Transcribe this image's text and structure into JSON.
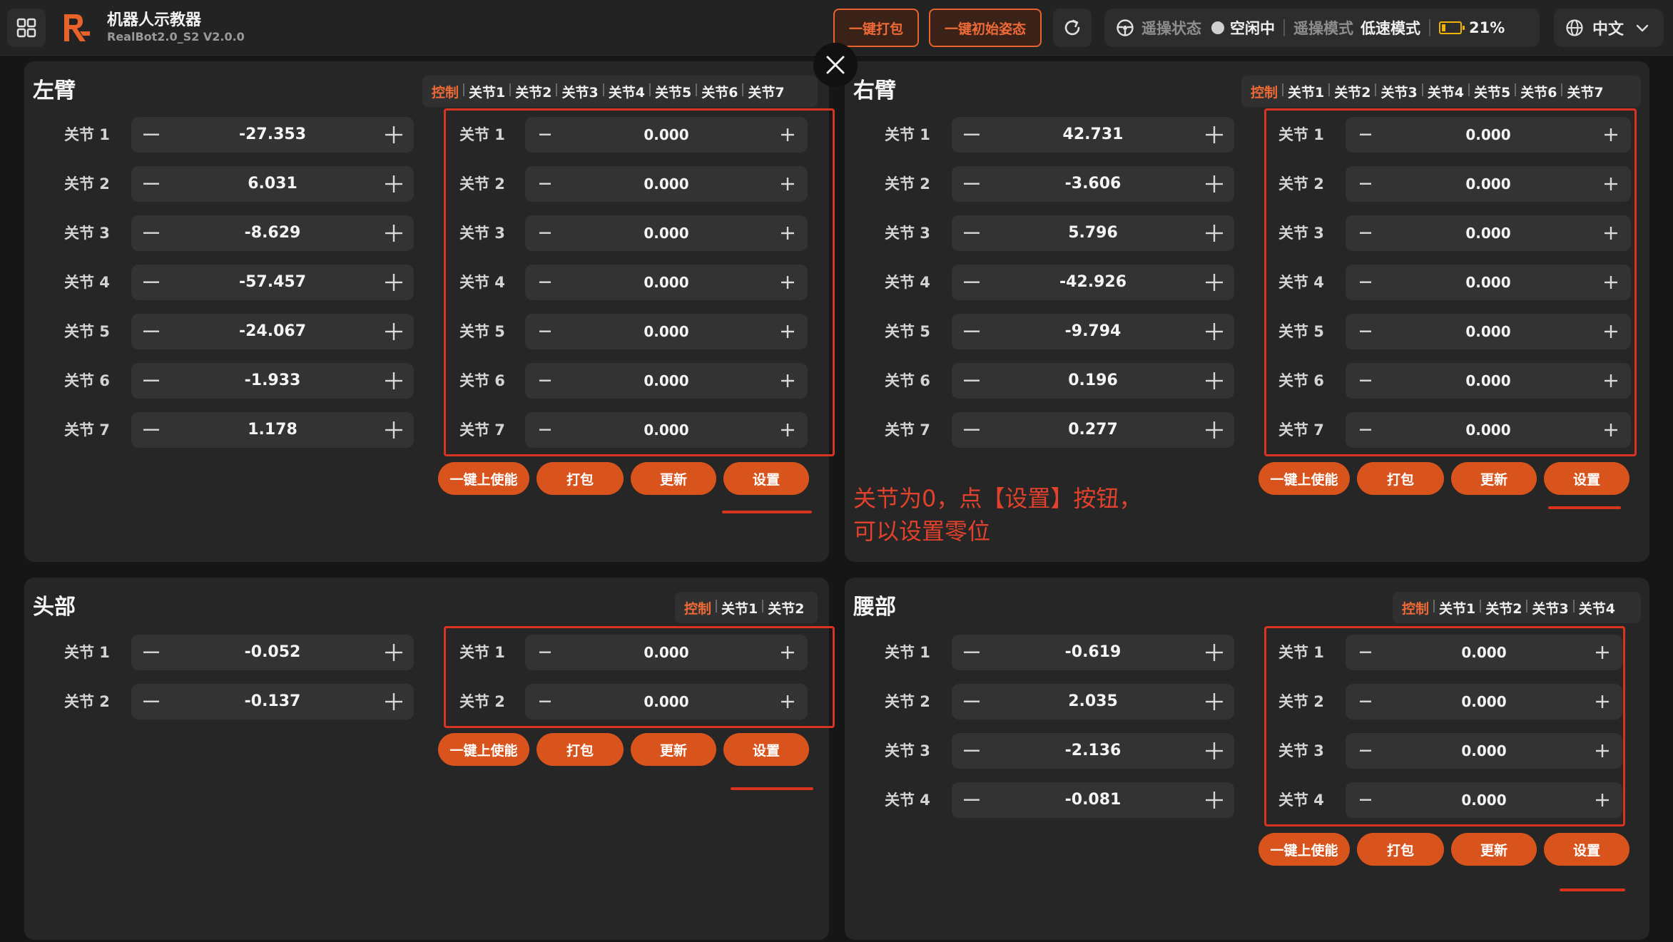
{
  "header": {
    "app_title": "机器人示教器",
    "app_version": "RealBot2.0_S2 V2.0.0",
    "pack_all_label": "一键打包",
    "init_pose_label": "一键初始姿态",
    "teleop_status_label": "遥操状态",
    "teleop_status_value": "空闲中",
    "teleop_mode_label": "遥操模式",
    "teleop_mode_value": "低速模式",
    "battery_percent": 21,
    "battery_text": "21%",
    "language": "中文"
  },
  "colors": {
    "accent": "#e8622c",
    "annotation": "#d9341f",
    "panel": "#262626",
    "battery": "#f0b400"
  },
  "common": {
    "tab_control": "控制",
    "btn_enable": "一键上使能",
    "btn_pack": "打包",
    "btn_update": "更新",
    "btn_set": "设置"
  },
  "left_arm": {
    "title": "左臂",
    "tabs": [
      "关节1",
      "关节2",
      "关节3",
      "关节4",
      "关节5",
      "关节6",
      "关节7"
    ],
    "joints": [
      {
        "label": "关节 1",
        "value": "-27.353",
        "offset": "0.000"
      },
      {
        "label": "关节 2",
        "value": "6.031",
        "offset": "0.000"
      },
      {
        "label": "关节 3",
        "value": "-8.629",
        "offset": "0.000"
      },
      {
        "label": "关节 4",
        "value": "-57.457",
        "offset": "0.000"
      },
      {
        "label": "关节 5",
        "value": "-24.067",
        "offset": "0.000"
      },
      {
        "label": "关节 6",
        "value": "-1.933",
        "offset": "0.000"
      },
      {
        "label": "关节 7",
        "value": "1.178",
        "offset": "0.000"
      }
    ]
  },
  "right_arm": {
    "title": "右臂",
    "tabs": [
      "关节1",
      "关节2",
      "关节3",
      "关节4",
      "关节5",
      "关节6",
      "关节7"
    ],
    "joints": [
      {
        "label": "关节 1",
        "value": "42.731",
        "offset": "0.000"
      },
      {
        "label": "关节 2",
        "value": "-3.606",
        "offset": "0.000"
      },
      {
        "label": "关节 3",
        "value": "5.796",
        "offset": "0.000"
      },
      {
        "label": "关节 4",
        "value": "-42.926",
        "offset": "0.000"
      },
      {
        "label": "关节 5",
        "value": "-9.794",
        "offset": "0.000"
      },
      {
        "label": "关节 6",
        "value": "0.196",
        "offset": "0.000"
      },
      {
        "label": "关节 7",
        "value": "0.277",
        "offset": "0.000"
      }
    ]
  },
  "head": {
    "title": "头部",
    "tabs": [
      "关节1",
      "关节2"
    ],
    "joints": [
      {
        "label": "关节 1",
        "value": "-0.052",
        "offset": "0.000"
      },
      {
        "label": "关节 2",
        "value": "-0.137",
        "offset": "0.000"
      }
    ]
  },
  "waist": {
    "title": "腰部",
    "tabs": [
      "关节1",
      "关节2",
      "关节3",
      "关节4"
    ],
    "joints": [
      {
        "label": "关节 1",
        "value": "-0.619",
        "offset": "0.000"
      },
      {
        "label": "关节 2",
        "value": "2.035",
        "offset": "0.000"
      },
      {
        "label": "关节 3",
        "value": "-2.136",
        "offset": "0.000"
      },
      {
        "label": "关节 4",
        "value": "-0.081",
        "offset": "0.000"
      }
    ]
  },
  "annotation": {
    "line1": "关节为0，点【设置】按钮，",
    "line2": "可以设置零位"
  }
}
